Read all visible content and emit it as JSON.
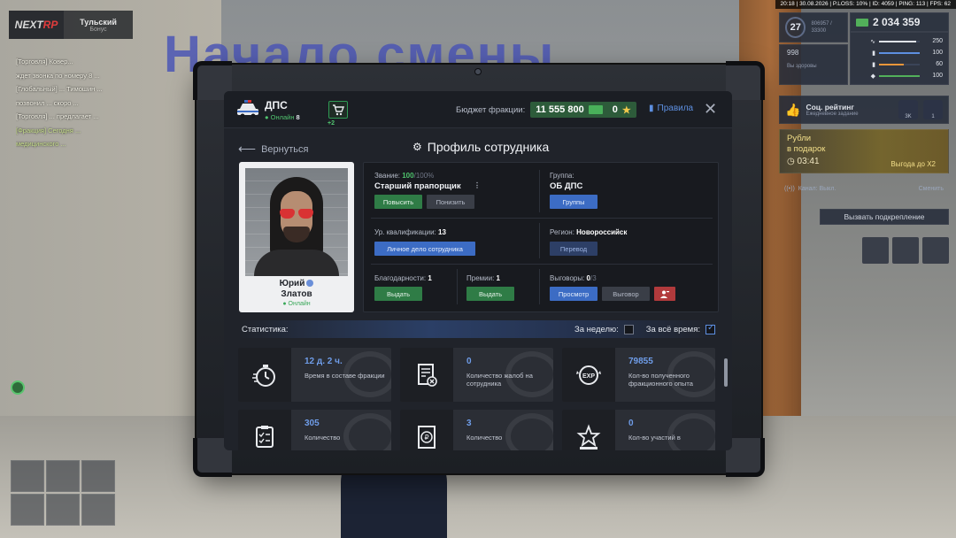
{
  "hud": {
    "topline": "20:18 | 30.08.2026 | P.LOSS: 10% | ID: 4059 | PING: 113 | FPS: 62",
    "level": "27",
    "xp": "806957 / 33300",
    "money": "2 034 359",
    "stat_left_1": "998",
    "stat_left_2": "Вы здоровы",
    "bars": [
      "250",
      "100",
      "60",
      "100"
    ],
    "social_title": "Соц. рейтинг",
    "social_sub": "Ежедневное задание",
    "social_btn1": "3K",
    "social_btn2": "1",
    "promo_line1": "Рубли",
    "promo_line2": "в подарок",
    "promo_timer": "03:41",
    "promo_badge": "Выгода до X2",
    "channel": "Канал: Выкл.",
    "channel_change": "Сменить",
    "backup": "Вызвать подкрепление"
  },
  "server": {
    "logo_main": "NEXT",
    "logo_accent": "RP",
    "name": "Тульский",
    "sub": "Бонус"
  },
  "background": {
    "title": "Начало смены"
  },
  "chat": [
    "[Торговля] Ковер...",
    "ждет звонка по номеру 8 ...",
    "[Глобальный] ... Тимошин ...",
    "позвонил ... скоро ...",
    "[Торговля] ... предлагает ...",
    "[Фракция] Сегодня ... ",
    "медицинского ..."
  ],
  "tablet": {
    "faction": "ДПС",
    "online_label": "Онлайн",
    "online_count": "8",
    "cart_badge": "+2",
    "budget_label": "Бюджет фракции:",
    "budget_value": "11 555 800",
    "budget_coins": "0",
    "rules": "Правила",
    "back": "Вернуться",
    "title": "Профиль сотрудника",
    "person": {
      "first": "Юрий",
      "last": "Златов",
      "status": "Онлайн"
    },
    "rank_label": "Звание:",
    "rank_value": "100",
    "rank_max": "/100%",
    "rank_name": "Старший прапорщик",
    "btn_promote": "Повысить",
    "btn_demote": "Понизить",
    "group_label": "Группа:",
    "group_value": "ОБ ДПС",
    "btn_groups": "Группы",
    "qual_label": "Ур. квалификации:",
    "qual_value": "13",
    "btn_dossier": "Личное дело сотрудника",
    "region_label": "Регион:",
    "region_value": "Новороссийск",
    "btn_transfer": "Перевод",
    "thanks_label": "Благодарности:",
    "thanks_value": "1",
    "btn_give1": "Выдать",
    "bonus_label": "Премии:",
    "bonus_value": "1",
    "btn_give2": "Выдать",
    "reprimand_label": "Выговоры:",
    "reprimand_value": "0",
    "reprimand_max": "/3",
    "btn_view": "Просмотр",
    "btn_reprimand": "Выговор",
    "stats_label": "Статистика:",
    "week_label": "За неделю:",
    "all_label": "За всё время:",
    "cards": [
      {
        "value": "12 д. 2 ч.",
        "label": "Время в составе фракции",
        "icon": "stopwatch-icon"
      },
      {
        "value": "0",
        "label": "Количество жалоб на сотрудника",
        "icon": "complaint-doc-icon"
      },
      {
        "value": "79855",
        "label": "Кол-во полученного фракционного опыта",
        "icon": "exp-badge-icon"
      },
      {
        "value": "305",
        "label": "Количество",
        "icon": "checklist-icon"
      },
      {
        "value": "3",
        "label": "Количество",
        "icon": "ruble-doc-icon"
      },
      {
        "value": "0",
        "label": "Кол-во участий в",
        "icon": "star-podium-icon"
      }
    ]
  },
  "colors": {
    "accent_blue": "#6f9de9",
    "green": "#4fc46d",
    "red": "#b13a3c"
  }
}
